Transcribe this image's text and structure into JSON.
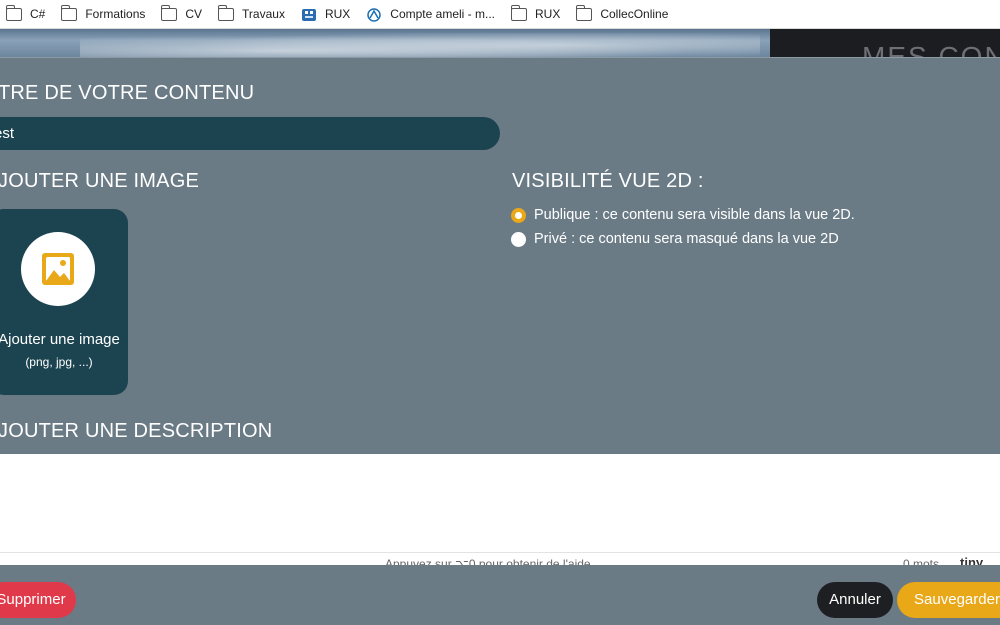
{
  "bookmarks": [
    {
      "label": "C#",
      "icon": "folder-icon"
    },
    {
      "label": "Formations",
      "icon": "folder-icon"
    },
    {
      "label": "CV",
      "icon": "folder-icon"
    },
    {
      "label": "Travaux",
      "icon": "folder-icon"
    },
    {
      "label": "RUX",
      "icon": "site-icon"
    },
    {
      "label": "Compte ameli - m...",
      "icon": "ameli-icon"
    },
    {
      "label": "RUX",
      "icon": "folder-icon"
    },
    {
      "label": "CollecOnline",
      "icon": "folder-icon"
    }
  ],
  "background": {
    "title": "MES CONT"
  },
  "form": {
    "title_label": "TRE DE VOTRE CONTENU",
    "title_value": "est",
    "image_label": "JOUTER UNE IMAGE",
    "image_button": {
      "title": "Ajouter une image",
      "subtitle": "(png, jpg, ...)",
      "icon": "image-icon"
    },
    "visibility_label": "VISIBILITÉ VUE 2D :",
    "visibility_options": [
      {
        "label": "Publique : ce contenu sera visible dans la vue 2D.",
        "checked": true
      },
      {
        "label": "Privé : ce contenu sera masqué dans la vue 2D",
        "checked": false
      }
    ],
    "description_label": "JOUTER UNE DESCRIPTION",
    "editor_status": {
      "help": "Appuyez sur ⌥0 pour obtenir de l'aide",
      "words": "0 mots",
      "brand": "tiny"
    }
  },
  "actions": {
    "delete": "Supprimer",
    "cancel": "Annuler",
    "save": "Sauvegarder"
  },
  "colors": {
    "accent": "#e8a818",
    "danger": "#e0394a",
    "dark_teal": "#1c4450",
    "modal_bg": "#6a7b86"
  }
}
